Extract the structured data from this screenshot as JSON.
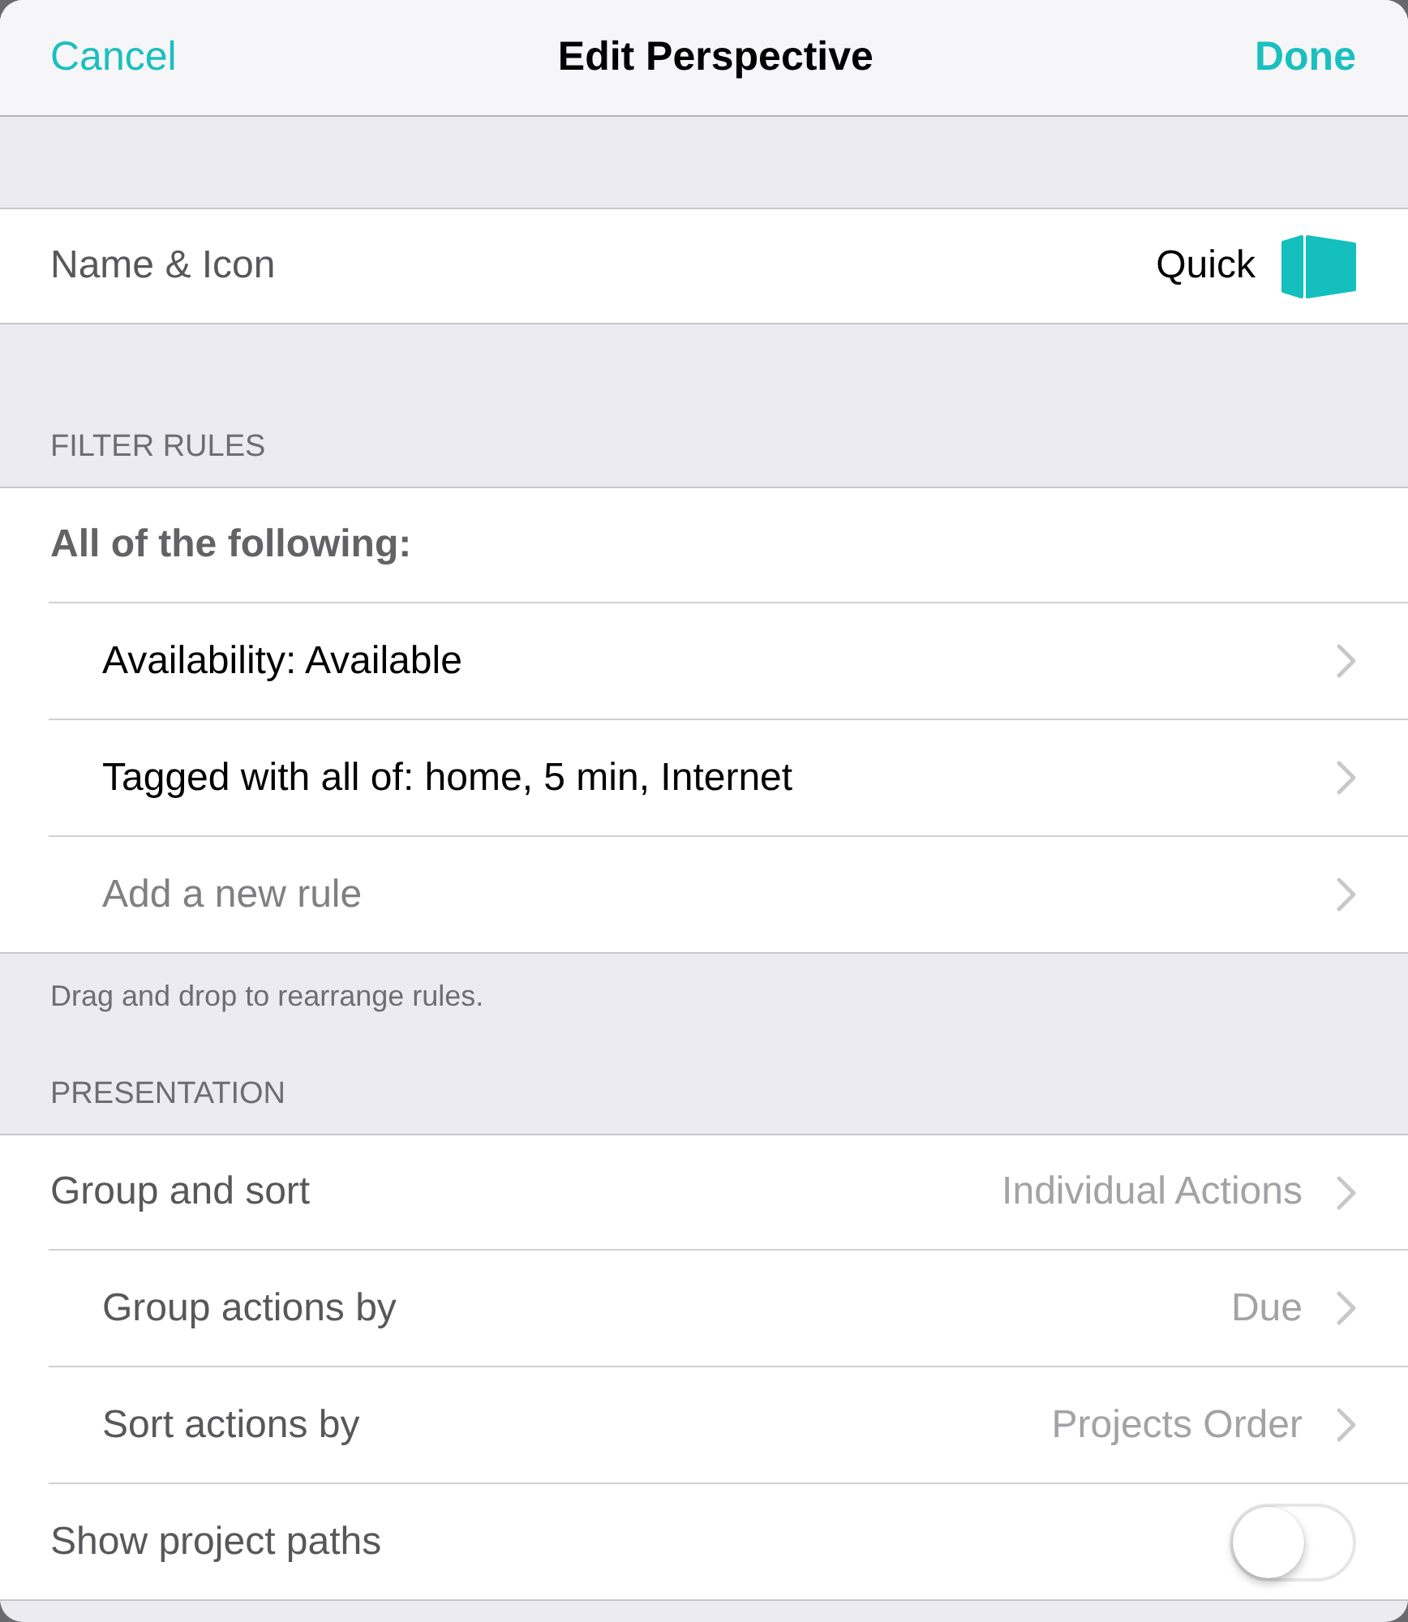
{
  "nav_bar": {
    "cancel": "Cancel",
    "title": "Edit Perspective",
    "done": "Done"
  },
  "name_row": {
    "label": "Name & Icon",
    "value": "Quick"
  },
  "sections": [
    {
      "header": "FILTER RULES",
      "rows": [
        {
          "kind": "group",
          "label": "All of the following:",
          "children": [
            {
              "kind": "rule",
              "label": "Availability: Available"
            },
            {
              "kind": "rule",
              "label": "Tagged with all of: home, 5 min, Internet"
            },
            {
              "kind": "add",
              "label": "Add a new rule"
            }
          ]
        }
      ],
      "footer": "Drag and drop to rearrange rules."
    },
    {
      "header": "PRESENTATION",
      "rows": [
        {
          "kind": "choice",
          "label": "Group and sort",
          "value": "Individual Actions",
          "children": [
            {
              "kind": "choice",
              "label": "Group actions by",
              "value": "Due"
            },
            {
              "kind": "choice",
              "label": "Sort actions by",
              "value": "Projects Order"
            }
          ]
        },
        {
          "kind": "toggle",
          "label": "Show project paths",
          "on": false
        }
      ]
    }
  ]
}
